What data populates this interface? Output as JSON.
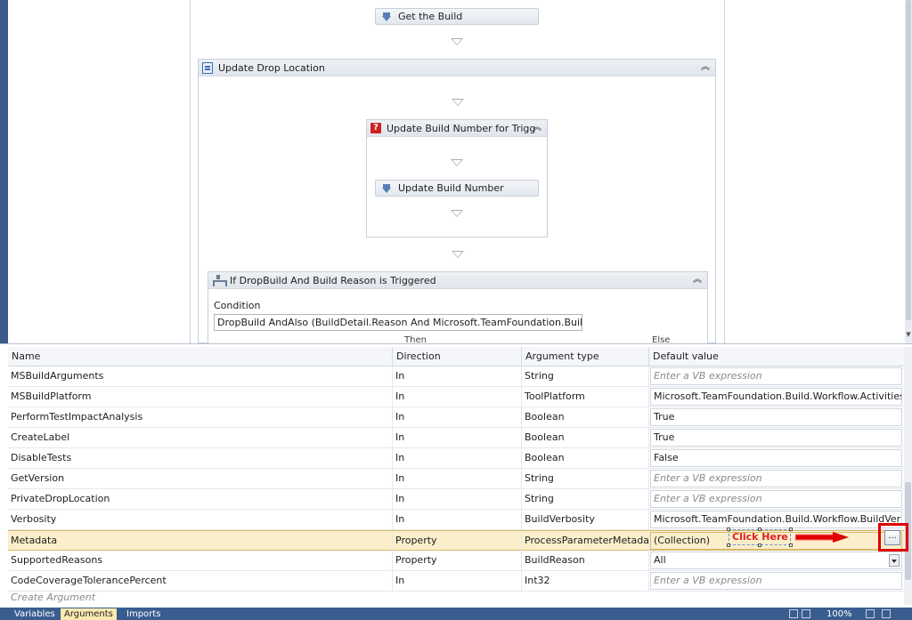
{
  "designer": {
    "get_build": "Get the Build",
    "update_drop_location": "Update Drop Location",
    "update_build_number_for_trigg": "Update Build Number for Trigg",
    "update_build_number": "Update Build Number",
    "if_dropbuild": "If DropBuild And Build Reason is Triggered",
    "condition_label": "Condition",
    "condition_value": "DropBuild AndAlso (BuildDetail.Reason And Microsoft.TeamFoundation.Build.Clien",
    "then_label": "Then",
    "else_label": "Else",
    "collapse_glyph": "︽"
  },
  "grid": {
    "headers": {
      "name": "Name",
      "direction": "Direction",
      "argument_type": "Argument type",
      "default_value": "Default value"
    },
    "rows": [
      {
        "name": "MSBuildArguments",
        "direction": "In",
        "type": "String",
        "default": "Enter a VB expression"
      },
      {
        "name": "MSBuildPlatform",
        "direction": "In",
        "type": "ToolPlatform",
        "default": "Microsoft.TeamFoundation.Build.Workflow.Activities.Too"
      },
      {
        "name": "PerformTestImpactAnalysis",
        "direction": "In",
        "type": "Boolean",
        "default": "True"
      },
      {
        "name": "CreateLabel",
        "direction": "In",
        "type": "Boolean",
        "default": "True"
      },
      {
        "name": "DisableTests",
        "direction": "In",
        "type": "Boolean",
        "default": "False"
      },
      {
        "name": "GetVersion",
        "direction": "In",
        "type": "String",
        "default": "Enter a VB expression"
      },
      {
        "name": "PrivateDropLocation",
        "direction": "In",
        "type": "String",
        "default": "Enter a VB expression"
      },
      {
        "name": "Verbosity",
        "direction": "In",
        "type": "BuildVerbosity",
        "default": "Microsoft.TeamFoundation.Build.Workflow.BuildVerbosit"
      },
      {
        "name": "Metadata",
        "direction": "Property",
        "type": "ProcessParameterMetadataC",
        "default": "(Collection)"
      },
      {
        "name": "SupportedReasons",
        "direction": "Property",
        "type": "BuildReason",
        "default": "All"
      },
      {
        "name": "CodeCoverageTolerancePercent",
        "direction": "In",
        "type": "Int32",
        "default": "Enter a VB expression"
      }
    ],
    "create_argument": "Create Argument",
    "ellipsis": "..."
  },
  "annotation": {
    "click_here": "Click Here"
  },
  "statusbar": {
    "variables_tab": "Variables",
    "arguments_tab": "Arguments",
    "imports_tab": "Imports",
    "zoom": "100%"
  },
  "colors": {
    "selected_row": "#fbeecb",
    "annotation_red": "#e00000",
    "statusbar": "#3a5d8f"
  }
}
